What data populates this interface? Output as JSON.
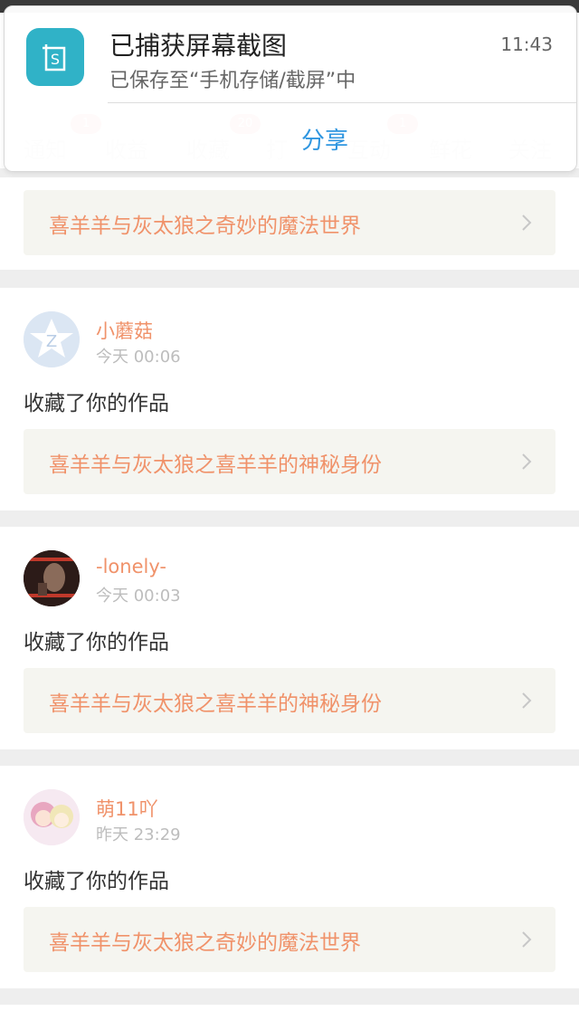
{
  "notification": {
    "title": "已捕获屏幕截图",
    "subtitle": "已保存至“手机存储/截屏”中",
    "time": "11:43",
    "action": "分享",
    "icon": "screenshot-icon"
  },
  "tabs": [
    {
      "label": "通知",
      "badge": "1"
    },
    {
      "label": "收益",
      "badge": ""
    },
    {
      "label": "收藏",
      "badge": "20"
    },
    {
      "label": "打",
      "badge": ""
    },
    {
      "label": "互动",
      "badge": "1"
    },
    {
      "label": "鲜花",
      "badge": ""
    },
    {
      "label": "关注",
      "badge": ""
    }
  ],
  "feed": {
    "top_link": "喜羊羊与灰太狼之奇妙的魔法世界",
    "items": [
      {
        "user": "小蘑菇",
        "time": "今天 00:06",
        "action": "收藏了你的作品",
        "work": "喜羊羊与灰太狼之喜羊羊的神秘身份",
        "avatar": "default-avatar"
      },
      {
        "user": "-lonely-",
        "time": "今天 00:03",
        "action": "收藏了你的作品",
        "work": "喜羊羊与灰太狼之喜羊羊的神秘身份",
        "avatar": "photo-avatar"
      },
      {
        "user": "萌11吖",
        "time": "昨天 23:29",
        "action": "收藏了你的作品",
        "work": "喜羊羊与灰太狼之奇妙的魔法世界",
        "avatar": "anime-avatar"
      }
    ]
  },
  "colors": {
    "accent_orange": "#f0926a",
    "share_blue": "#2f96e0",
    "icon_teal": "#30b2c7",
    "badge_red": "#f26b5b"
  }
}
